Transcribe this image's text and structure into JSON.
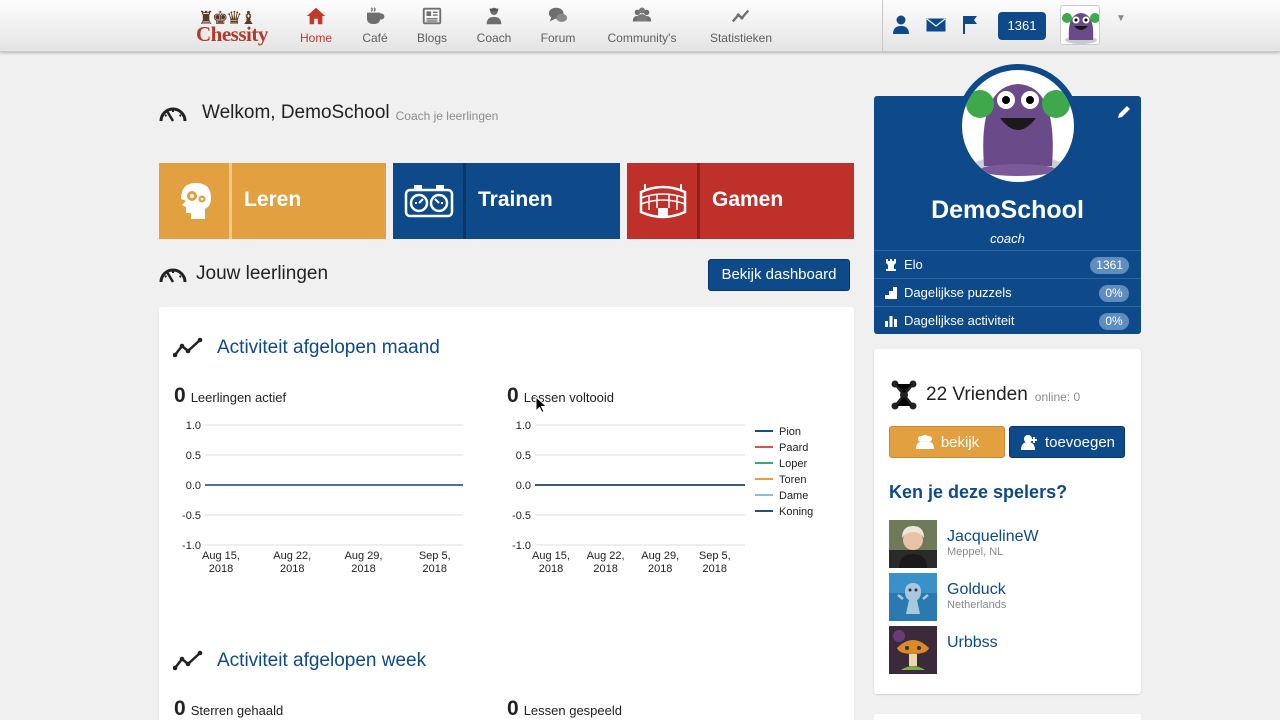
{
  "brand": {
    "logo_text": "Chessity",
    "colors": {
      "primary": "#0e4a8a",
      "orange": "#e2a040",
      "red": "#c0302a"
    }
  },
  "nav": [
    {
      "label": "Home",
      "icon": "home-icon",
      "active": true
    },
    {
      "label": "Café",
      "icon": "coffee-cup-icon"
    },
    {
      "label": "Blogs",
      "icon": "newspaper-icon"
    },
    {
      "label": "Coach",
      "icon": "coach-icon"
    },
    {
      "label": "Forum",
      "icon": "speech-bubbles-icon"
    },
    {
      "label": "Community's",
      "icon": "people-group-icon"
    },
    {
      "label": "Statistieken",
      "icon": "line-chart-icon"
    }
  ],
  "topbar": {
    "elo": "1361"
  },
  "welcome": {
    "title": "Welkom, DemoSchool",
    "subtitle": "Coach je leerlingen"
  },
  "tiles": [
    {
      "label": "Leren",
      "icon": "brain-gears-icon"
    },
    {
      "label": "Trainen",
      "icon": "chess-clock-icon"
    },
    {
      "label": "Gamen",
      "icon": "stadium-icon"
    }
  ],
  "students": {
    "title": "Jouw leerlingen",
    "dashboard_button": "Bekijk dashboard",
    "month": {
      "title": "Activiteit afgelopen maand",
      "active_count": "0",
      "active_label": "Leerlingen actief",
      "lessons_count": "0",
      "lessons_label": "Lessen voltooid"
    },
    "week": {
      "title": "Activiteit afgelopen week",
      "stars_count": "0",
      "stars_label": "Sterren gehaald",
      "lessons_count": "0",
      "lessons_label": "Lessen gespeeld"
    }
  },
  "chart_data": [
    {
      "type": "line",
      "categories": [
        "Aug 15, 2018",
        "Aug 22, 2018",
        "Aug 29, 2018",
        "Sep 5, 2018"
      ],
      "y_ticks": [
        "1.0",
        "0.5",
        "0.0",
        "-0.5",
        "-1.0"
      ],
      "ylim": [
        -1,
        1
      ],
      "grid": true,
      "series": [
        {
          "values": [
            0,
            0,
            0,
            0
          ],
          "color": "#2f5f8f"
        }
      ]
    },
    {
      "type": "line",
      "categories": [
        "Aug 15, 2018",
        "Aug 22, 2018",
        "Aug 29, 2018",
        "Sep 5, 2018"
      ],
      "y_ticks": [
        "1.0",
        "0.5",
        "0.0",
        "-0.5",
        "-1.0"
      ],
      "ylim": [
        -1,
        1
      ],
      "grid": true,
      "legend_position": "right",
      "series": [
        {
          "name": "Pion",
          "values": [
            0,
            0,
            0,
            0
          ],
          "color": "#1f4e79"
        },
        {
          "name": "Paard",
          "values": [
            0,
            0,
            0,
            0
          ],
          "color": "#d9534f"
        },
        {
          "name": "Loper",
          "values": [
            0,
            0,
            0,
            0
          ],
          "color": "#3fa86f"
        },
        {
          "name": "Toren",
          "values": [
            0,
            0,
            0,
            0
          ],
          "color": "#e2a040"
        },
        {
          "name": "Dame",
          "values": [
            0,
            0,
            0,
            0
          ],
          "color": "#8fb8dc"
        },
        {
          "name": "Koning",
          "values": [
            0,
            0,
            0,
            0
          ],
          "color": "#2e4f6e"
        }
      ]
    }
  ],
  "profile": {
    "name": "DemoSchool",
    "role": "coach",
    "stats": [
      {
        "label": "Elo",
        "value": "1361",
        "icon": "rook-icon"
      },
      {
        "label": "Dagelijkse puzzels",
        "value": "0%",
        "icon": "puzzle-stairs-icon"
      },
      {
        "label": "Dagelijkse activiteit",
        "value": "0%",
        "icon": "bar-chart-icon"
      }
    ]
  },
  "friends": {
    "count_label": "22 Vrienden",
    "online_label": "online: 0",
    "view_button": "bekijk",
    "add_button": "toevoegen",
    "suggest_title": "Ken je deze spelers?",
    "players": [
      {
        "name": "JacquelineW",
        "location": "Meppel, NL"
      },
      {
        "name": "Golduck",
        "location": "Netherlands"
      },
      {
        "name": "Urbbss",
        "location": ""
      }
    ]
  }
}
